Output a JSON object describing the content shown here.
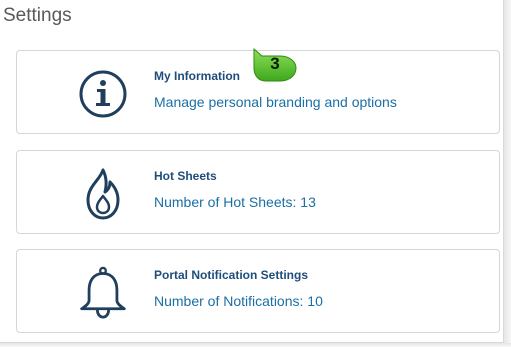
{
  "page": {
    "title": "Settings"
  },
  "cards": [
    {
      "title": "My Information",
      "subtitle": "Manage personal branding and options",
      "icon": "info-circle-icon"
    },
    {
      "title": "Hot Sheets",
      "subtitle": "Number of Hot Sheets: 13",
      "icon": "flame-icon"
    },
    {
      "title": "Portal Notification Settings",
      "subtitle": "Number of Notifications: 10",
      "icon": "bell-icon"
    }
  ],
  "callout": {
    "step": "3",
    "color": "#5cc72e"
  },
  "colors": {
    "icon_stroke": "#1f3f5c",
    "title": "#1f4d7a",
    "subtitle": "#1a6fa5"
  }
}
